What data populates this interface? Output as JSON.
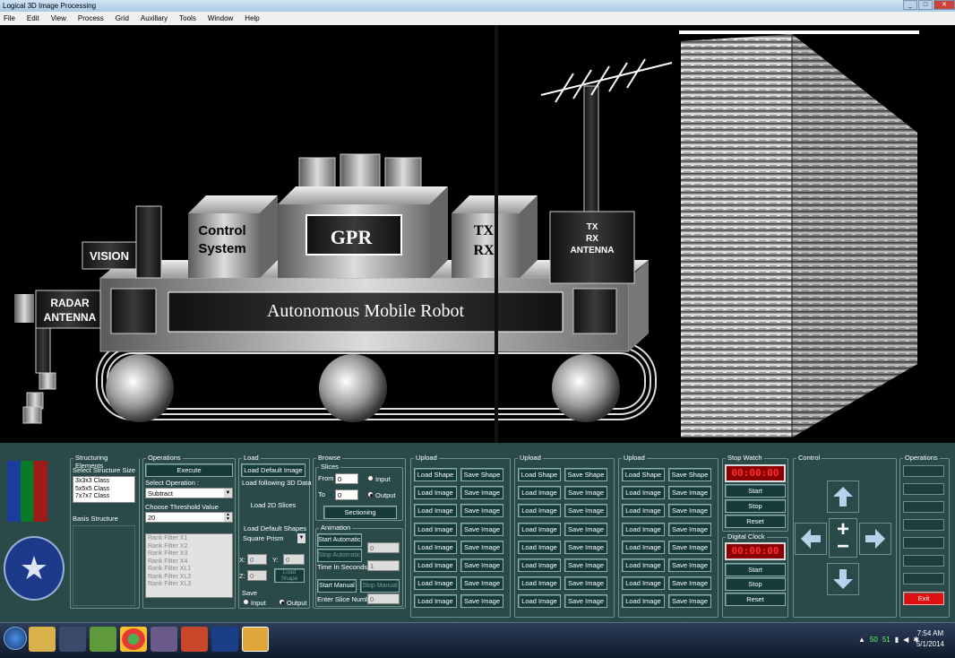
{
  "window": {
    "title": "Logical 3D Image Processing"
  },
  "menu": [
    "File",
    "Edit",
    "View",
    "Process",
    "Grid",
    "Auxillary",
    "Tools",
    "Window",
    "Help"
  ],
  "diagram": {
    "vision": "VISION",
    "control1": "Control",
    "control2": "System",
    "gpr": "GPR",
    "txrx1": "TX",
    "txrx2": "RX",
    "ant1": "TX",
    "ant2": "RX",
    "ant3": "ANTENNA",
    "radar1": "RADAR",
    "radar2": "ANTENNA",
    "robot": "Autonomous Mobile Robot"
  },
  "structuring": {
    "label": "Structuring Elements",
    "size_label": "Select Structure Size",
    "sizes": [
      "3x3x3 Class",
      "5x5x5 Class",
      "7x7x7 Class"
    ],
    "basis": "Basis Structure"
  },
  "operations": {
    "label": "Operations",
    "execute": "Execute",
    "select_label": "Select Operation :",
    "selected": "Subtract",
    "threshold_label": "Choose Threshold Value",
    "threshold": "20",
    "filters": [
      "Rank Filter X1",
      "Rank Filter X2",
      "Rank Filter X3",
      "Rank Filter X4",
      "Rank Filter XL1",
      "Rank Filter XL2",
      "Rank Filter XL3"
    ]
  },
  "load": {
    "label": "Load",
    "default_image": "Load Default Image",
    "following": "Load following 3D Data",
    "slices2d": "Load 2D Slices",
    "shapes": "Load Default Shapes",
    "shape_sel": "Square Prism",
    "x": "X:",
    "xv": "0",
    "y": "Y:",
    "yv": "0",
    "z": "Z:",
    "zv": "0",
    "load_shape": "Load Shape",
    "save": "Save",
    "input": "Input",
    "output": "Output"
  },
  "browse": {
    "label": "Browse",
    "slices": "Slices",
    "from": "From",
    "from_v": "0",
    "to": "To",
    "to_v": "0",
    "input": "Input",
    "output": "Output",
    "sectioning": "Sectioning",
    "animation": "Animation",
    "start_auto": "Start Automatic",
    "stop_auto": "Stop Automatic",
    "auto_v": "0",
    "time": "Time In Seconds",
    "time_v": "1",
    "start_manual": "Start Manual",
    "stop_manual": "Stop Manual",
    "enter_slice": "Enter Slice Number",
    "slice_v": "0"
  },
  "uploads": {
    "label": "Upload",
    "load_shape": "Load Shape",
    "save_shape": "Save Shape",
    "load_image": "Load Image",
    "save_image": "Save Image"
  },
  "stopwatch": {
    "label": "Stop Watch",
    "time": "00:00:00",
    "start": "Start",
    "stop": "Stop",
    "reset": "Reset"
  },
  "digitalclock": {
    "label": "Digital Clock",
    "time": "00:00:00",
    "start": "Start",
    "stop": "Stop",
    "reset": "Reset"
  },
  "control": {
    "label": "Control"
  },
  "ops_right": {
    "label": "Operations",
    "exit": "Exit"
  },
  "taskbar": {
    "time": "7:54 AM",
    "date": "5/1/2014",
    "tray1": "50",
    "tray2": "51"
  },
  "colors": {
    "panel": "#2a4a4a",
    "exit": "#e01010",
    "accent": "#ff3030"
  }
}
